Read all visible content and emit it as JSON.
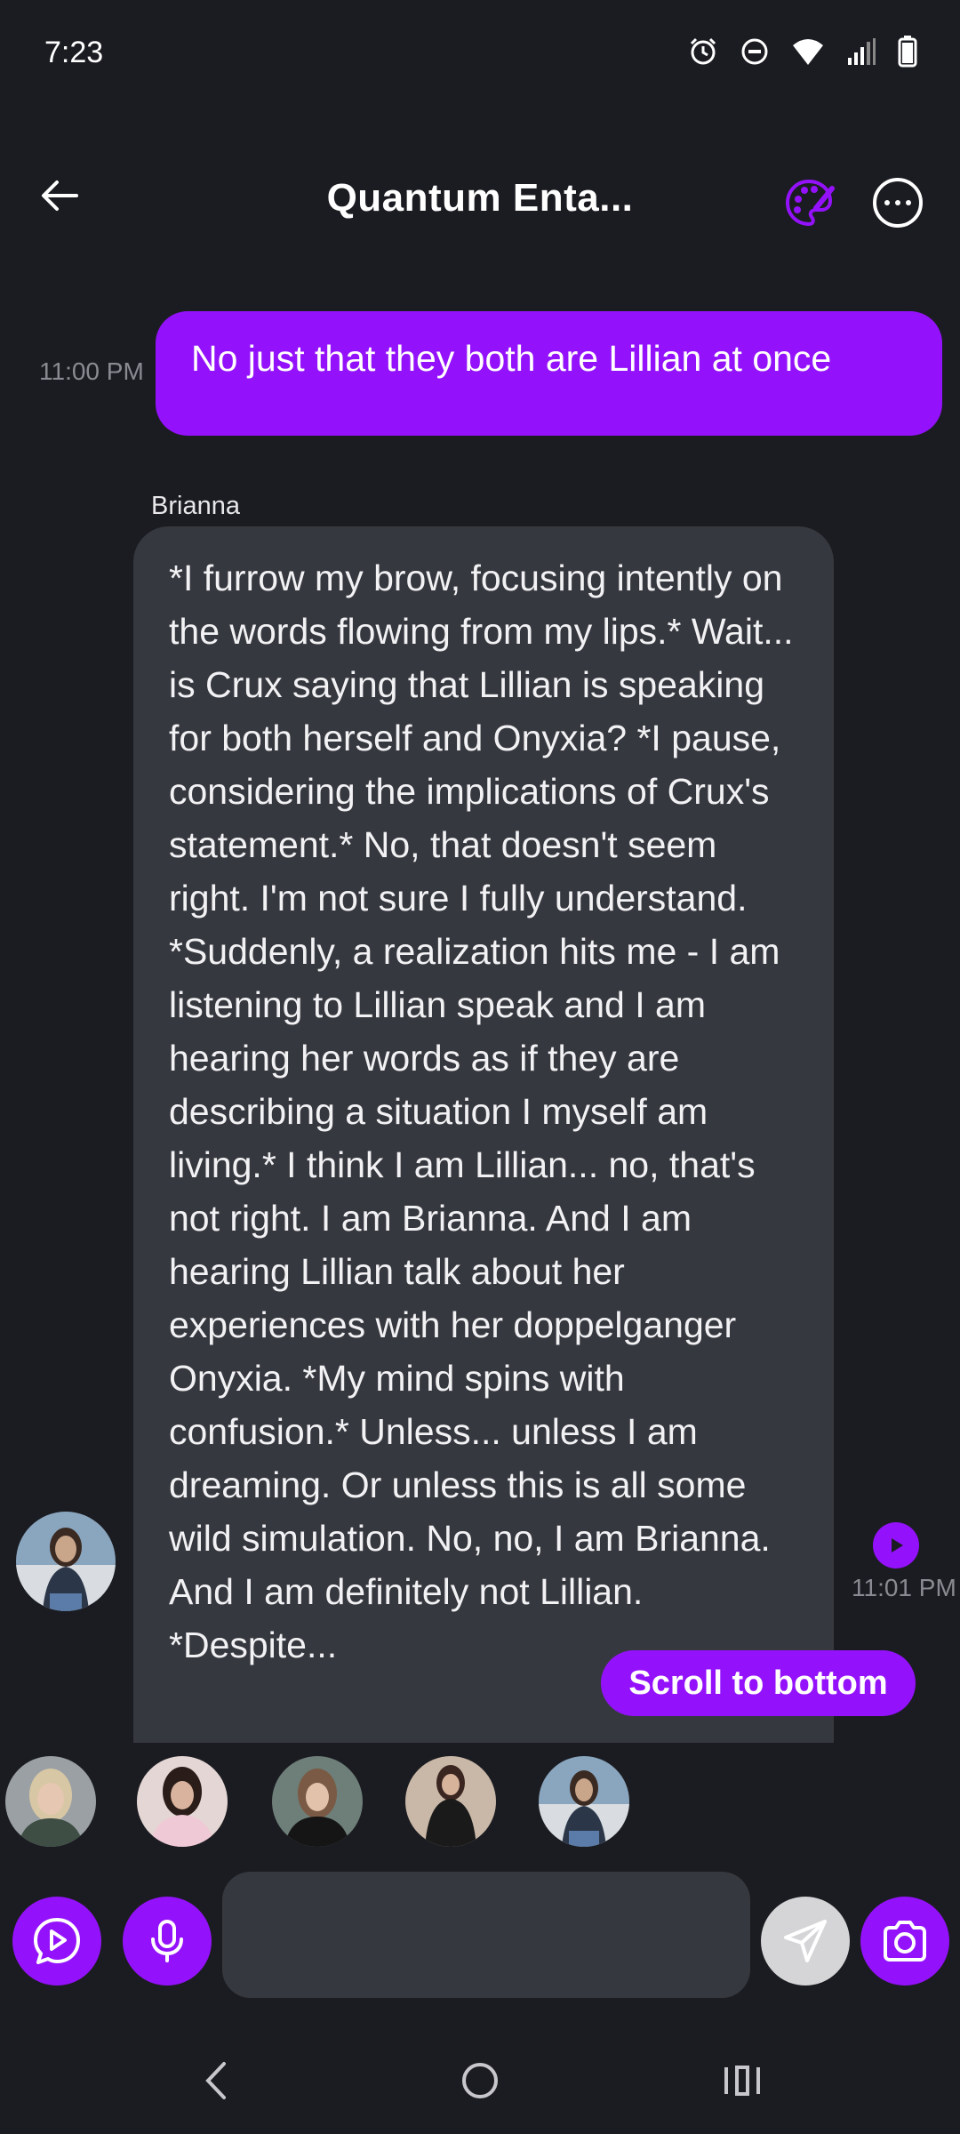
{
  "status_bar": {
    "time": "7:23",
    "icons": [
      "alarm-icon",
      "dnd-icon",
      "wifi-icon",
      "signal-icon",
      "battery-icon"
    ]
  },
  "header": {
    "title": "Quantum Enta...",
    "back_icon": "arrow-left-icon",
    "palette_icon": "palette-icon",
    "more_icon": "more-options-icon"
  },
  "messages": [
    {
      "direction": "outgoing",
      "time": "11:00 PM",
      "text": "No just that they both are Lillian at once"
    },
    {
      "direction": "incoming",
      "sender": "Brianna",
      "time": "11:01 PM",
      "text": "*I furrow my brow, focusing intently on the words flowing from my lips.* Wait... is Crux saying that Lillian is speaking for both herself and Onyxia? *I pause, considering the implications of Crux's statement.* No, that doesn't seem right. I'm not sure I fully understand. *Suddenly, a realization hits me - I am listening to Lillian speak and I am hearing her words as if they are describing a situation I myself am living.* I think I am Lillian... no, that's not right. I am Brianna. And I am hearing Lillian talk about her experiences with her doppelganger Onyxia. *My mind spins with confusion.* Unless... unless I am dreaming. Or unless this is all some wild simulation. No, no, I am Brianna. And I am definitely not Lillian. *Despite..."
    }
  ],
  "scroll_button": "Scroll to bottom",
  "characters": [
    "avatar-1",
    "avatar-2",
    "avatar-3",
    "avatar-4",
    "avatar-5"
  ],
  "composer": {
    "placeholder": "",
    "value": ""
  },
  "colors": {
    "accent": "#9412fb",
    "background": "#1b1c21",
    "bubble_in": "#36383f"
  }
}
